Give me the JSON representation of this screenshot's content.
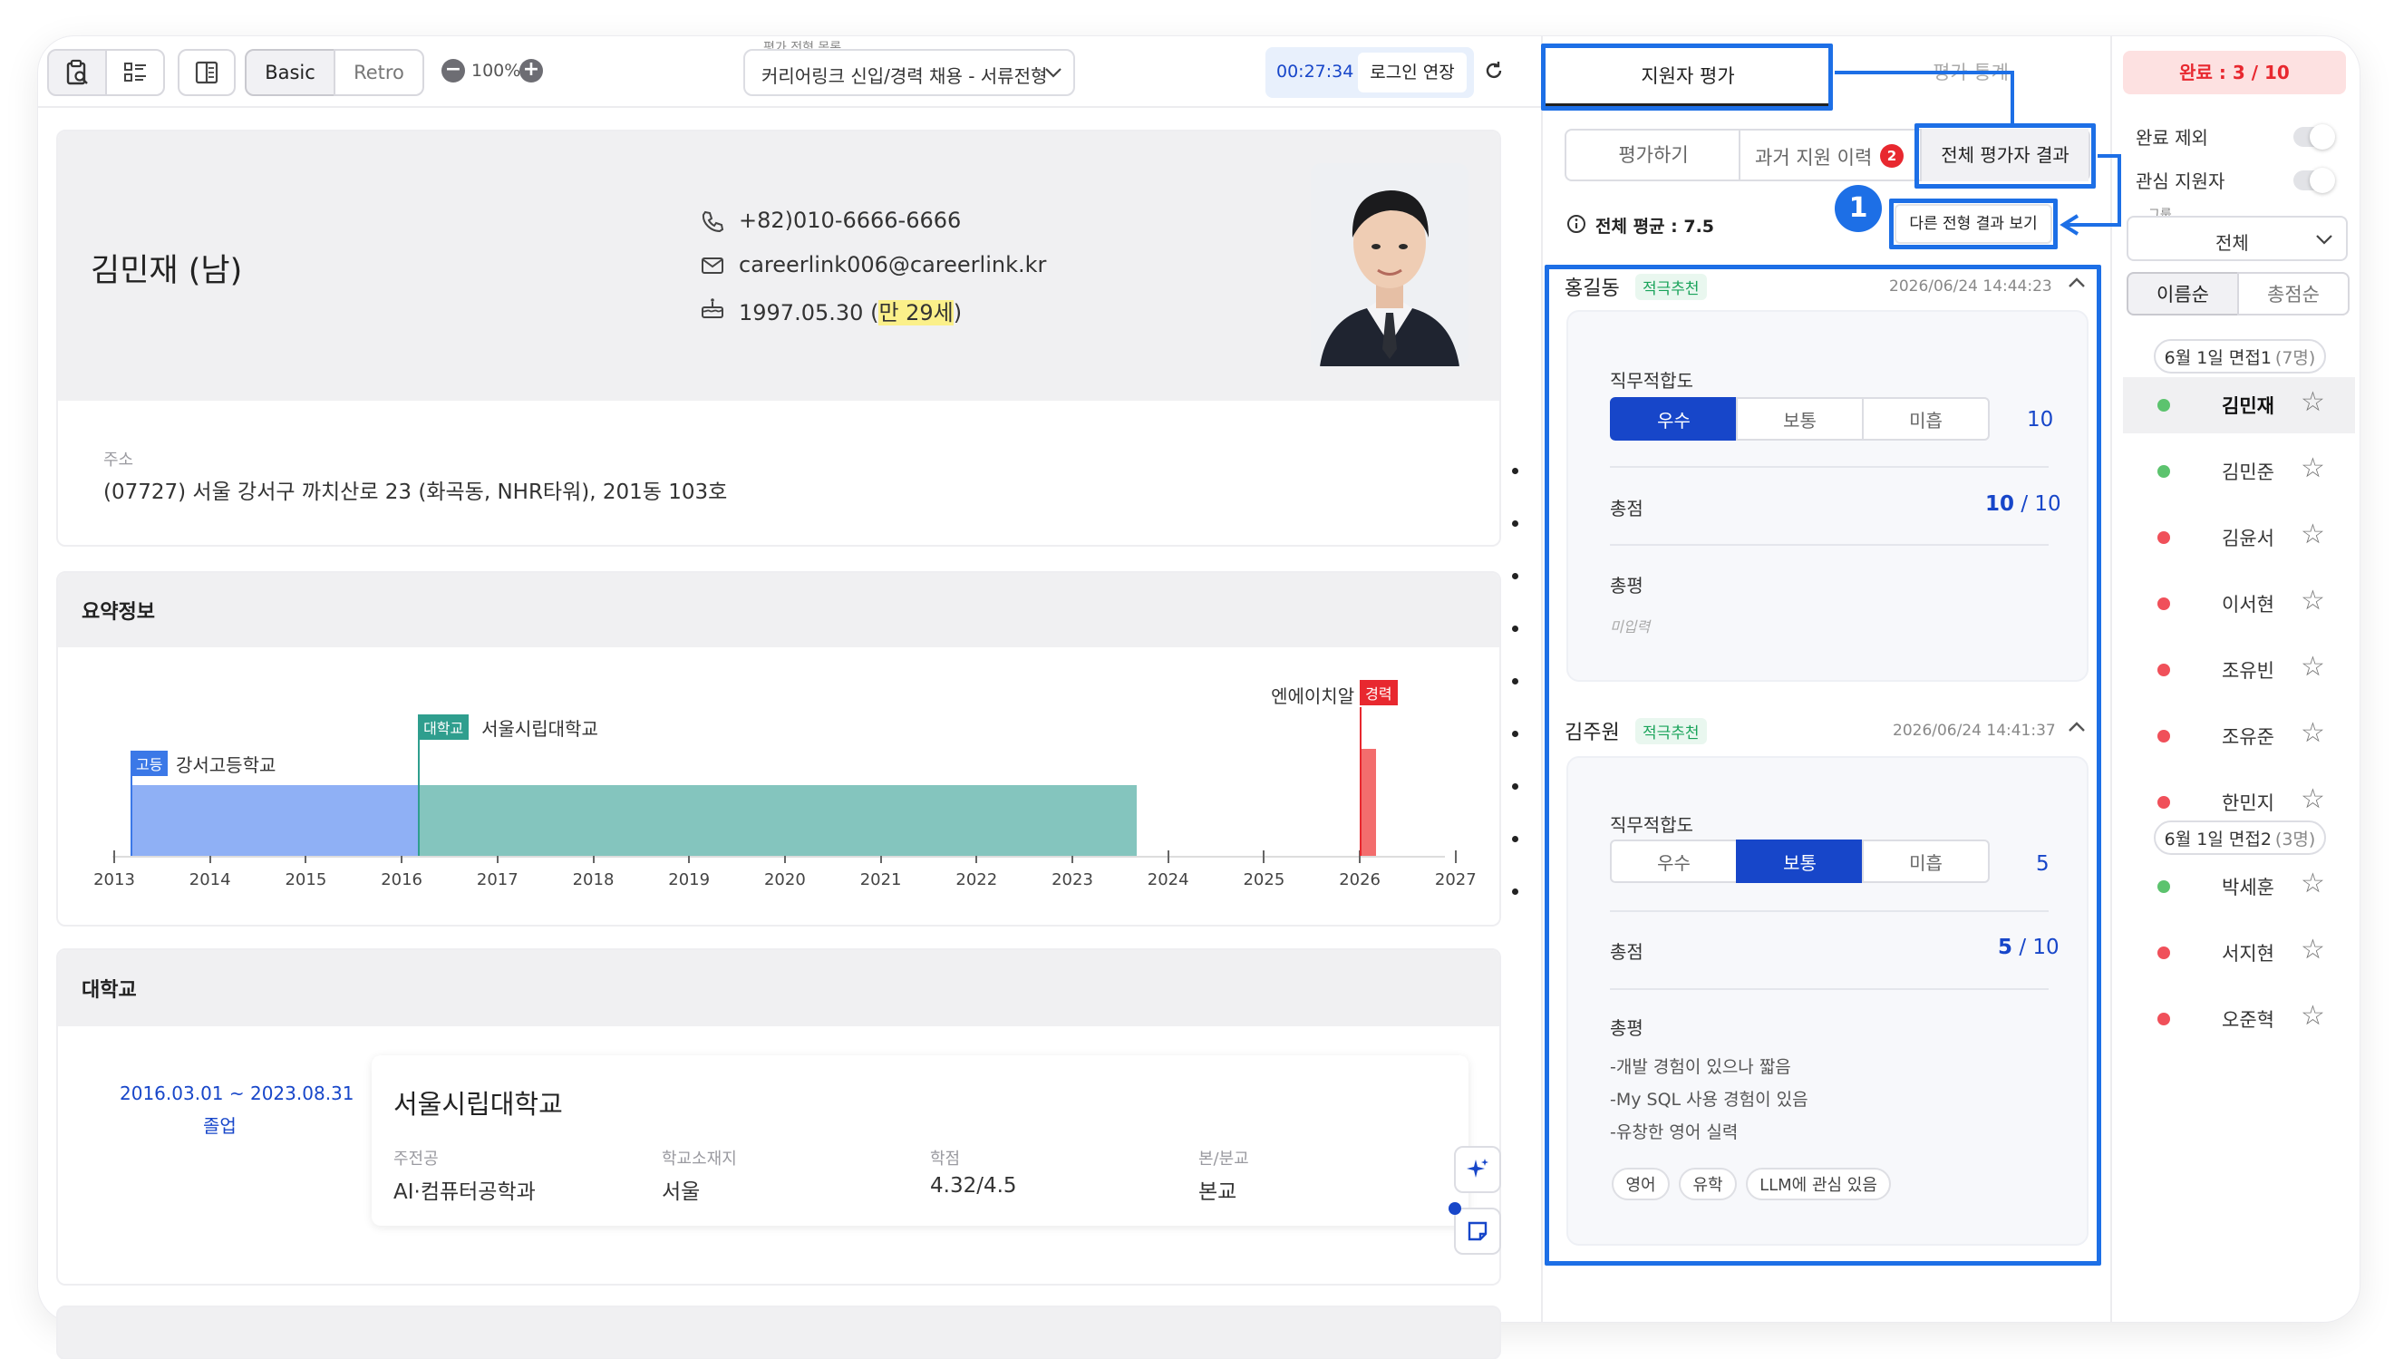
{
  "toolbar": {
    "view_basic": "Basic",
    "view_retro": "Retro",
    "zoom": "100%",
    "process_small_label": "평가 전형 목록",
    "process_value": "커리어링크 신입/경력 채용 - 서류전형",
    "timer": "00:27:34",
    "extend_login": "로그인 연장"
  },
  "profile": {
    "name": "김민재 (남)",
    "phone": "+82)010-6666-6666",
    "email": "careerlink006@careerlink.kr",
    "birth": "1997.05.30",
    "age_prefix": "(",
    "age": "만 29세",
    "age_suffix": ")",
    "address_label": "주소",
    "address": "(07727) 서울 강서구 까치산로 23 (화곡동, NHR타워), 201동 103호"
  },
  "summary": {
    "title": "요약정보",
    "timeline": {
      "years": [
        "2013",
        "2014",
        "2015",
        "2016",
        "2017",
        "2018",
        "2019",
        "2020",
        "2021",
        "2022",
        "2023",
        "2024",
        "2025",
        "2026",
        "2027"
      ],
      "entries": [
        {
          "tag": "고등",
          "label": "강서고등학교",
          "color": "#8fb0f5",
          "tag_color": "#3b78e7",
          "start": 2013.17,
          "end": 2016.17
        },
        {
          "tag": "대학교",
          "label": "서울시립대학교",
          "color": "#84c5be",
          "tag_color": "#2f9e8e",
          "start": 2016.17,
          "end": 2023.67
        },
        {
          "tag": "경력",
          "label": "엔에이치알",
          "color": "#f36d6d",
          "tag_color": "#e8282f",
          "start": 2026.0,
          "end": 2026.17
        }
      ]
    }
  },
  "university": {
    "section_title": "대학교",
    "period": "2016.03.01 ~ 2023.08.31",
    "status": "졸업",
    "name": "서울시립대학교",
    "fields": [
      {
        "label": "주전공",
        "value": "AI·컴퓨터공학과"
      },
      {
        "label": "학교소재지",
        "value": "서울"
      },
      {
        "label": "학점",
        "value": "4.32/4.5"
      },
      {
        "label": "본/분교",
        "value": "본교"
      }
    ]
  },
  "eval_panel": {
    "tab_applicant_eval": "지원자 평가",
    "tab_eval_stats": "평가 통계",
    "sub_evaluate": "평가하기",
    "sub_past_history": "과거 지원 이력",
    "past_history_badge": "2",
    "sub_all_results": "전체 평가자 결과",
    "callout_number": "1",
    "other_stage_btn": "다른 전형 결과 보기",
    "overall_avg": "전체 평균 : 7.5",
    "evaluators": [
      {
        "name": "홍길동",
        "tag": "적극추천",
        "date": "2026/06/24 14:44:23",
        "criteria_label": "직무적합도",
        "grades": [
          "우수",
          "보통",
          "미흡"
        ],
        "selected": 0,
        "score": "10",
        "total_label": "총점",
        "total_score": "10",
        "total_max": " / 10",
        "comment_label": "총평",
        "comment_lines": [
          "미입력"
        ],
        "chips": []
      },
      {
        "name": "김주원",
        "tag": "적극추천",
        "date": "2026/06/24 14:41:37",
        "criteria_label": "직무적합도",
        "grades": [
          "우수",
          "보통",
          "미흡"
        ],
        "selected": 1,
        "score": "5",
        "total_label": "총점",
        "total_score": "5",
        "total_max": " / 10",
        "comment_label": "총평",
        "comment_lines": [
          "-개발 경험이 있으나 짧음",
          "-My SQL 사용 경험이 있음",
          "-유창한 영어 실력"
        ],
        "chips": [
          "영어",
          "유학",
          "LLM에 관심 있음"
        ]
      }
    ]
  },
  "applicants": {
    "complete": "완료 : 3 / 10",
    "exclude_complete": "완료 제외",
    "interest_applicants": "관심 지원자",
    "group_label": "그룹",
    "group_value": "전체",
    "sort_name": "이름순",
    "sort_score": "총점순",
    "groups": [
      {
        "title": "6월 1일 면접1",
        "count": "(7명)",
        "members": [
          {
            "name": "김민재",
            "status": "green",
            "selected": true
          },
          {
            "name": "김민준",
            "status": "green"
          },
          {
            "name": "김윤서",
            "status": "red"
          },
          {
            "name": "이서현",
            "status": "red"
          },
          {
            "name": "조유빈",
            "status": "red"
          },
          {
            "name": "조유준",
            "status": "red"
          },
          {
            "name": "한민지",
            "status": "red"
          }
        ]
      },
      {
        "title": "6월 1일 면접2",
        "count": "(3명)",
        "members": [
          {
            "name": "박세훈",
            "status": "green"
          },
          {
            "name": "서지현",
            "status": "red"
          },
          {
            "name": "오준혁",
            "status": "red"
          }
        ]
      }
    ],
    "colors": {
      "green": "#5cc36e",
      "red": "#f0505a"
    }
  }
}
